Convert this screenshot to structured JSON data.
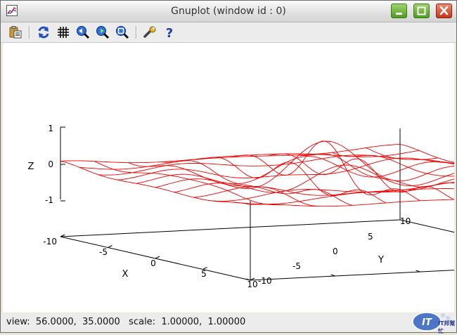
{
  "window": {
    "title": "Gnuplot (window id : 0)"
  },
  "toolbar": {
    "buttons": [
      {
        "name": "copy-to-clipboard",
        "icon": "clipboard-icon"
      },
      {
        "name": "replot",
        "icon": "refresh-icon"
      },
      {
        "name": "toggle-grid",
        "icon": "grid-icon"
      },
      {
        "name": "previous-zoom",
        "icon": "zoom-previous-icon"
      },
      {
        "name": "next-zoom",
        "icon": "zoom-next-icon"
      },
      {
        "name": "autoscale",
        "icon": "zoom-autoscale-icon"
      },
      {
        "name": "settings",
        "icon": "wrench-icon"
      },
      {
        "name": "help",
        "icon": "help-icon"
      }
    ]
  },
  "chart_data": {
    "type": "surface",
    "surface_function": "sinc: sin(r)/r, r = sqrt(x^2 + y^2)",
    "color": "#ee0000",
    "xlabel": "X",
    "ylabel": "Y",
    "zlabel": "Z",
    "xlim": [
      -10,
      10
    ],
    "ylim": [
      -10,
      10
    ],
    "zlim": [
      -1,
      1
    ],
    "xticks": [
      "-10",
      "-5",
      "0",
      "5",
      "10"
    ],
    "yticks": [
      "-10",
      "-5",
      "0",
      "5",
      "10"
    ],
    "zticks": [
      "1",
      "0",
      "-1"
    ],
    "mesh_lines": 11,
    "view_rot_x": 56,
    "view_rot_z": 35
  },
  "status": {
    "text": "view:  56.0000,  35.0000   scale:  1.00000,  1.00000"
  },
  "watermark": {
    "text": "IT邦幫忙"
  }
}
